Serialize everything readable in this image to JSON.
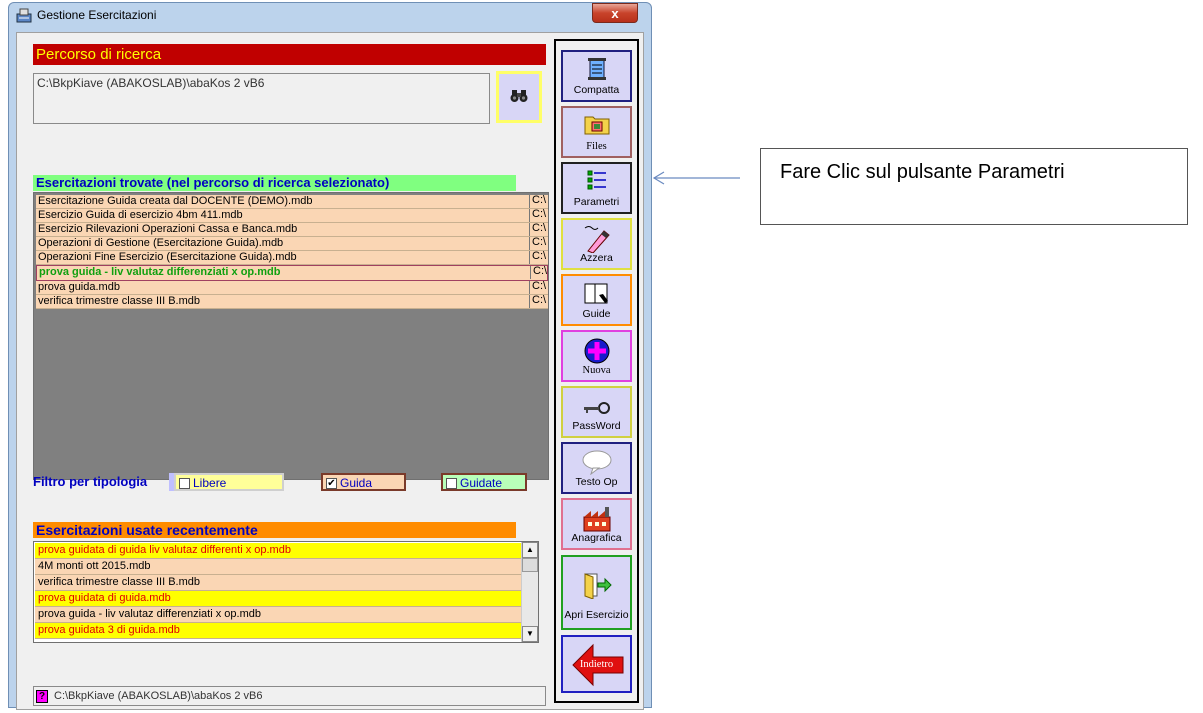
{
  "window": {
    "title": "Gestione Esercitazioni",
    "close_label": "x"
  },
  "search": {
    "header": "Percorso di ricerca",
    "path": "C:\\BkpKiave (ABAKOSLAB)\\abaKos 2 vB6"
  },
  "found": {
    "header": "Esercitazioni trovate (nel percorso di ricerca selezionato)",
    "rows": [
      {
        "name": "Esercitazione Guida creata dal DOCENTE (DEMO).mdb",
        "col2": "C:\\"
      },
      {
        "name": "Esercizio Guida di esercizio 4bm 411.mdb",
        "col2": "C:\\"
      },
      {
        "name": "Esercizio Rilevazioni Operazioni Cassa e Banca.mdb",
        "col2": "C:\\"
      },
      {
        "name": "Operazioni di Gestione (Esercitazione Guida).mdb",
        "col2": "C:\\"
      },
      {
        "name": "Operazioni Fine Esercizio (Esercitazione Guida).mdb",
        "col2": "C:\\"
      },
      {
        "name": "prova guida - liv valutaz differenziati x op.mdb",
        "col2": "C:\\"
      },
      {
        "name": "prova guida.mdb",
        "col2": "C:\\"
      },
      {
        "name": "verifica trimestre classe III B.mdb",
        "col2": "C:\\"
      }
    ]
  },
  "filter": {
    "label": "Filtro per tipologia",
    "libere": {
      "label": "Libere",
      "checked": ""
    },
    "guida": {
      "label": "Guida",
      "checked": "✔"
    },
    "guidate": {
      "label": "Guidate",
      "checked": ""
    }
  },
  "recent": {
    "header": "Esercitazioni usate recentemente",
    "rows": [
      "prova guidata di guida liv valutaz differenti x op.mdb",
      "4M monti ott 2015.mdb",
      "verifica trimestre classe III B.mdb",
      "prova guidata di guida.mdb",
      "prova guida - liv valutaz differenziati x op.mdb",
      "prova guidata 3 di guida.mdb"
    ],
    "scroll_up": "▲",
    "scroll_down": "▼"
  },
  "status": {
    "help": "?",
    "path": "C:\\BkpKiave (ABAKOSLAB)\\abaKos 2 vB6"
  },
  "toolbar": {
    "compatta": "Compatta",
    "files": "Files",
    "parametri": "Parametri",
    "azzera": "Azzera",
    "guide": "Guide",
    "nuova": "Nuova",
    "password": "PassWord",
    "testo_op": "Testo Op",
    "anagrafica": "Anagrafica",
    "apri": "Apri Esercizio",
    "indietro": "Indietro"
  },
  "annotation": {
    "text": "Fare Clic sul pulsante Parametri"
  },
  "colors": {
    "accent_red": "#c00000",
    "header_green": "#80ff80",
    "header_orange": "#ff8c00",
    "row_peach": "#fad6b4",
    "button_lavender": "#d8d6f6"
  }
}
